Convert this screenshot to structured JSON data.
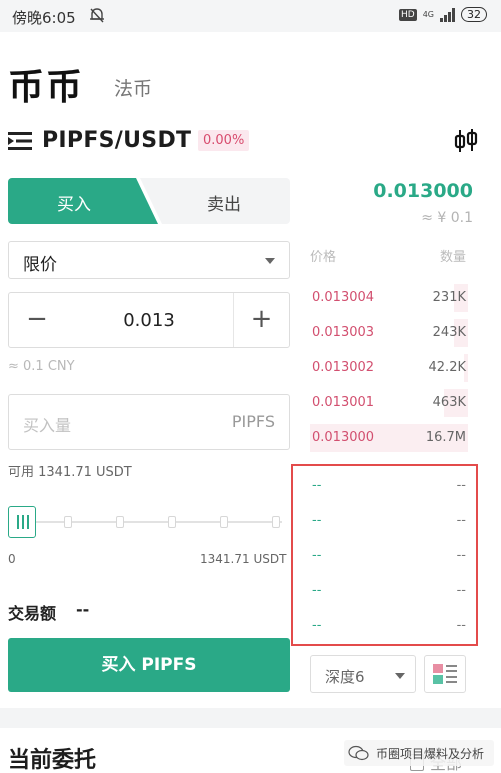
{
  "status_bar": {
    "time": "傍晚6:05",
    "hd": "HD",
    "network": "4G",
    "battery": "32"
  },
  "header": {
    "title": "币币",
    "subtitle": "法币"
  },
  "pair": {
    "symbol": "PIPFS/USDT",
    "change": "0.00%"
  },
  "tabs": {
    "buy": "买入",
    "sell": "卖出"
  },
  "price": {
    "last": "0.013000",
    "cny": "≈ ¥ 0.1"
  },
  "order_form": {
    "order_type": "限价",
    "price_value": "0.013",
    "price_minus": "−",
    "price_plus": "+",
    "price_cny": "≈ 0.1 CNY",
    "amount_placeholder": "买入量",
    "amount_unit": "PIPFS",
    "available": "可用 1341.71 USDT",
    "slider_min": "0",
    "slider_max": "1341.71 USDT",
    "slider_fraction": 0,
    "trade_amount_label": "交易额",
    "trade_amount_value": "--",
    "submit": "买入 PIPFS"
  },
  "order_book": {
    "price_header": "价格",
    "qty_header": "数量",
    "asks": [
      {
        "price": "0.013004",
        "qty": "231K"
      },
      {
        "price": "0.013003",
        "qty": "243K"
      },
      {
        "price": "0.013002",
        "qty": "42.2K"
      },
      {
        "price": "0.013001",
        "qty": "463K"
      },
      {
        "price": "0.013000",
        "qty": "16.7M"
      }
    ],
    "bids": [
      {
        "price": "--",
        "qty": "--"
      },
      {
        "price": "--",
        "qty": "--"
      },
      {
        "price": "--",
        "qty": "--"
      },
      {
        "price": "--",
        "qty": "--"
      },
      {
        "price": "--",
        "qty": "--"
      }
    ],
    "depth": "深度6"
  },
  "open_orders": {
    "title": "当前委托",
    "all": "全部"
  },
  "watermark": {
    "text": "币圈项目爆料及分析"
  },
  "colors": {
    "buy": "#2aa987",
    "sell": "#d24f6f",
    "highlight_box": "#e34b4b"
  }
}
